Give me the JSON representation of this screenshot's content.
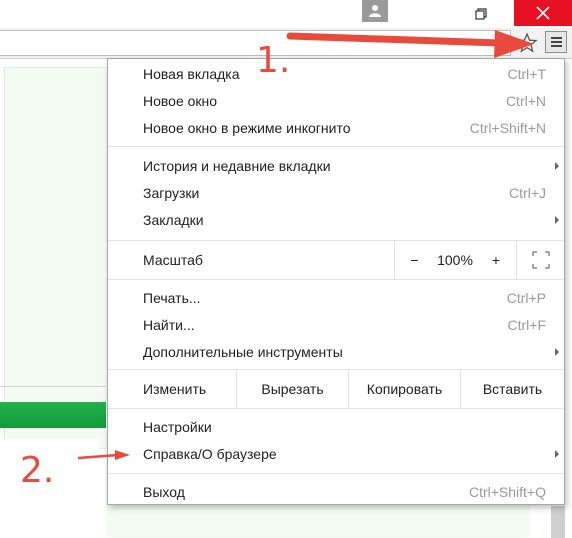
{
  "menu": {
    "group1": [
      {
        "label": "Новая вкладка",
        "shortcut": "Ctrl+T"
      },
      {
        "label": "Новое окно",
        "shortcut": "Ctrl+N"
      },
      {
        "label": "Новое окно в режиме инкогнито",
        "shortcut": "Ctrl+Shift+N"
      }
    ],
    "group2": [
      {
        "label": "История и недавние вкладки",
        "shortcut": ""
      },
      {
        "label": "Загрузки",
        "shortcut": "Ctrl+J"
      },
      {
        "label": "Закладки",
        "shortcut": ""
      }
    ],
    "zoom": {
      "label": "Масштаб",
      "minus": "−",
      "value": "100%",
      "plus": "+"
    },
    "group3": [
      {
        "label": "Печать...",
        "shortcut": "Ctrl+P"
      },
      {
        "label": "Найти...",
        "shortcut": "Ctrl+F"
      },
      {
        "label": "Дополнительные инструменты",
        "shortcut": ""
      }
    ],
    "edit": {
      "label": "Изменить",
      "cut": "Вырезать",
      "copy": "Копировать",
      "paste": "Вставить"
    },
    "group4": [
      {
        "label": "Настройки",
        "shortcut": ""
      },
      {
        "label": "Справка/О браузере",
        "shortcut": ""
      }
    ],
    "exit": {
      "label": "Выход",
      "shortcut": "Ctrl+Shift+Q"
    }
  },
  "annotations": {
    "step1": "1.",
    "step2": "2."
  },
  "colors": {
    "close": "#e81123",
    "annotation": "#e84a3e",
    "accent_green": "#22b14c"
  },
  "icons": {
    "user": "user-icon",
    "restore": "restore-icon",
    "close": "close-icon",
    "star": "star-icon",
    "menu": "hamburger-menu-icon",
    "fullscreen": "fullscreen-icon"
  }
}
